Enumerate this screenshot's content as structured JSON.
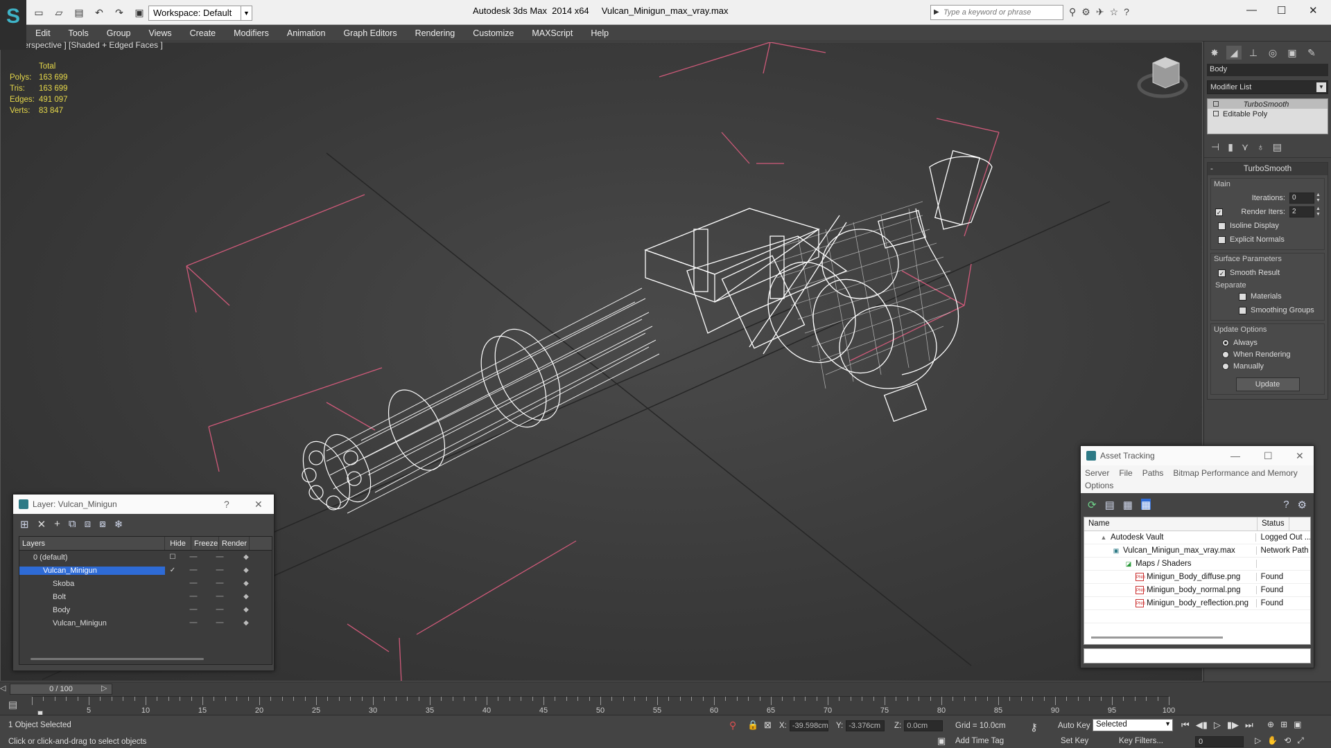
{
  "app": {
    "title": "Autodesk 3ds Max  2014 x64     Vulcan_Minigun_max_vray.max",
    "workspace": "Workspace: Default",
    "search_placeholder": "Type a keyword or phrase"
  },
  "menu": [
    "Edit",
    "Tools",
    "Group",
    "Views",
    "Create",
    "Modifiers",
    "Animation",
    "Graph Editors",
    "Rendering",
    "Customize",
    "MAXScript",
    "Help"
  ],
  "viewport": {
    "label": "[+] [Perspective ] [Shaded + Edged Faces ]",
    "stats_header": "Total",
    "stats": [
      {
        "k": "Polys:",
        "v": "163 699"
      },
      {
        "k": "Tris:",
        "v": "163 699"
      },
      {
        "k": "Edges:",
        "v": "491 097"
      },
      {
        "k": "Verts:",
        "v": "83 847"
      }
    ]
  },
  "command_panel": {
    "object_name": "Body",
    "modifier_list": "Modifier List",
    "stack": [
      "TurboSmooth",
      "Editable Poly"
    ],
    "rollout_title": "TurboSmooth",
    "main_group": "Main",
    "iterations_label": "Iterations:",
    "iterations_value": "0",
    "render_iters_label": "Render Iters:",
    "render_iters_value": "2",
    "isoline": "Isoline Display",
    "explicit": "Explicit Normals",
    "surface_group": "Surface Parameters",
    "smooth_result": "Smooth Result",
    "separate": "Separate",
    "materials": "Materials",
    "smoothing_groups": "Smoothing Groups",
    "update_group": "Update Options",
    "always": "Always",
    "when_rendering": "When Rendering",
    "manually": "Manually",
    "update_btn": "Update"
  },
  "layer_panel": {
    "title": "Layer: Vulcan_Minigun",
    "help": "?",
    "cols": [
      "Layers",
      "Hide",
      "Freeze",
      "Render"
    ],
    "rows": [
      {
        "name": "0 (default)",
        "indent": 1,
        "sel": false
      },
      {
        "name": "Vulcan_Minigun",
        "indent": 1,
        "sel": true
      },
      {
        "name": "Skoba",
        "indent": 2,
        "sel": false
      },
      {
        "name": "Bolt",
        "indent": 2,
        "sel": false
      },
      {
        "name": "Body",
        "indent": 2,
        "sel": false
      },
      {
        "name": "Vulcan_Minigun",
        "indent": 2,
        "sel": false
      }
    ]
  },
  "asset_panel": {
    "title": "Asset Tracking",
    "menu": [
      "Server",
      "File",
      "Paths",
      "Bitmap Performance and Memory",
      "Options"
    ],
    "cols": [
      "Name",
      "Status"
    ],
    "rows": [
      {
        "name": "Autodesk Vault",
        "status": "Logged Out ...",
        "indent": 1,
        "icon": "vault-icon"
      },
      {
        "name": "Vulcan_Minigun_max_vray.max",
        "status": "Network Path",
        "indent": 2,
        "icon": "max-file-icon"
      },
      {
        "name": "Maps / Shaders",
        "status": "",
        "indent": 3,
        "icon": "maps-icon"
      },
      {
        "name": "Minigun_Body_diffuse.png",
        "status": "Found",
        "indent": 4,
        "icon": "png-icon"
      },
      {
        "name": "Minigun_body_normal.png",
        "status": "Found",
        "indent": 4,
        "icon": "png-icon"
      },
      {
        "name": "Minigun_body_reflection.png",
        "status": "Found",
        "indent": 4,
        "icon": "png-icon"
      }
    ]
  },
  "timeline": {
    "frame": "0 / 100",
    "ticks": [
      "5",
      "10",
      "15",
      "20",
      "25",
      "30",
      "35",
      "40",
      "45",
      "50",
      "55",
      "60",
      "65",
      "70",
      "75",
      "80",
      "85",
      "90",
      "95",
      "100"
    ]
  },
  "status": {
    "selected": "1 Object Selected",
    "hint": "Click or click-and-drag to select objects",
    "x_label": "X:",
    "x_value": "-39.598cm",
    "y_label": "Y:",
    "y_value": "-3.376cm",
    "z_label": "Z:",
    "z_value": "0.0cm",
    "grid": "Grid = 10.0cm",
    "auto_key": "Auto Key",
    "set_key": "Set Key",
    "key_mode": "Selected",
    "key_filters": "Key Filters...",
    "add_time_tag": "Add Time Tag",
    "frame_value": "0"
  },
  "colors": {
    "stats": "#e6d84a",
    "selection": "#2e6bd6",
    "grid": "#d05a7a"
  }
}
